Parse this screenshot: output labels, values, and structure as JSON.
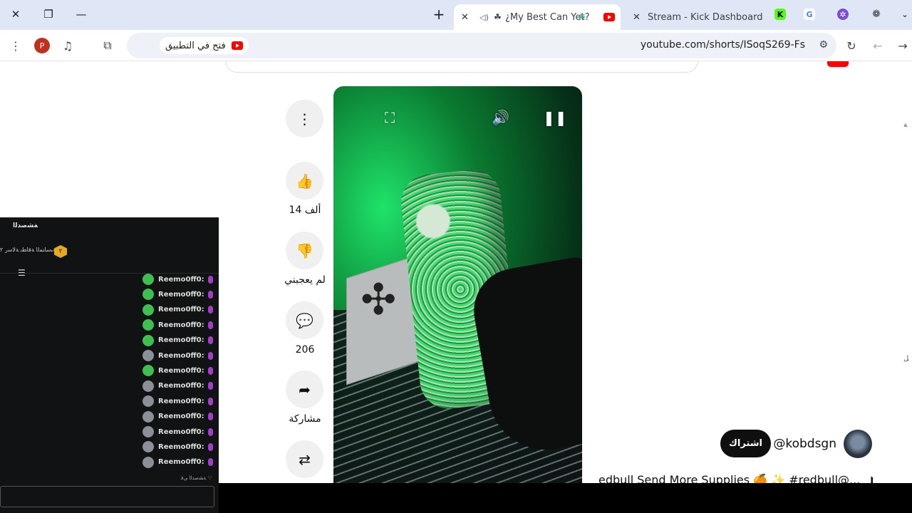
{
  "browser": {
    "tabs": [
      {
        "title": "¿My Best Can Yet?",
        "active": true
      },
      {
        "title": "Stream - Kick Dashboard",
        "active": false
      }
    ],
    "new_tab_glyph": "+",
    "url": "youtube.com/shorts/ISoqS269-Fs",
    "open_in_app": "فتح في التطبيق",
    "profile_letter": "P"
  },
  "short": {
    "likes": "14 ألف",
    "dislike_label": "لم يعجبني",
    "comments": "206",
    "share_label": "مشاركة",
    "channel_handle": "@kobdsgn",
    "subscribe_label": "اشتراك",
    "caption": "edbull Send More Supplies 🍊 ✨ #redbull@..."
  },
  "chat_overlay": {
    "message_user": "Reemo0ff0:",
    "message_count": 13,
    "colors": {
      "accent": "#a33ec9",
      "bg": "#111214"
    }
  },
  "icons": {
    "close": "close-icon",
    "restore": "restore-icon",
    "minimize": "minimize-icon"
  }
}
